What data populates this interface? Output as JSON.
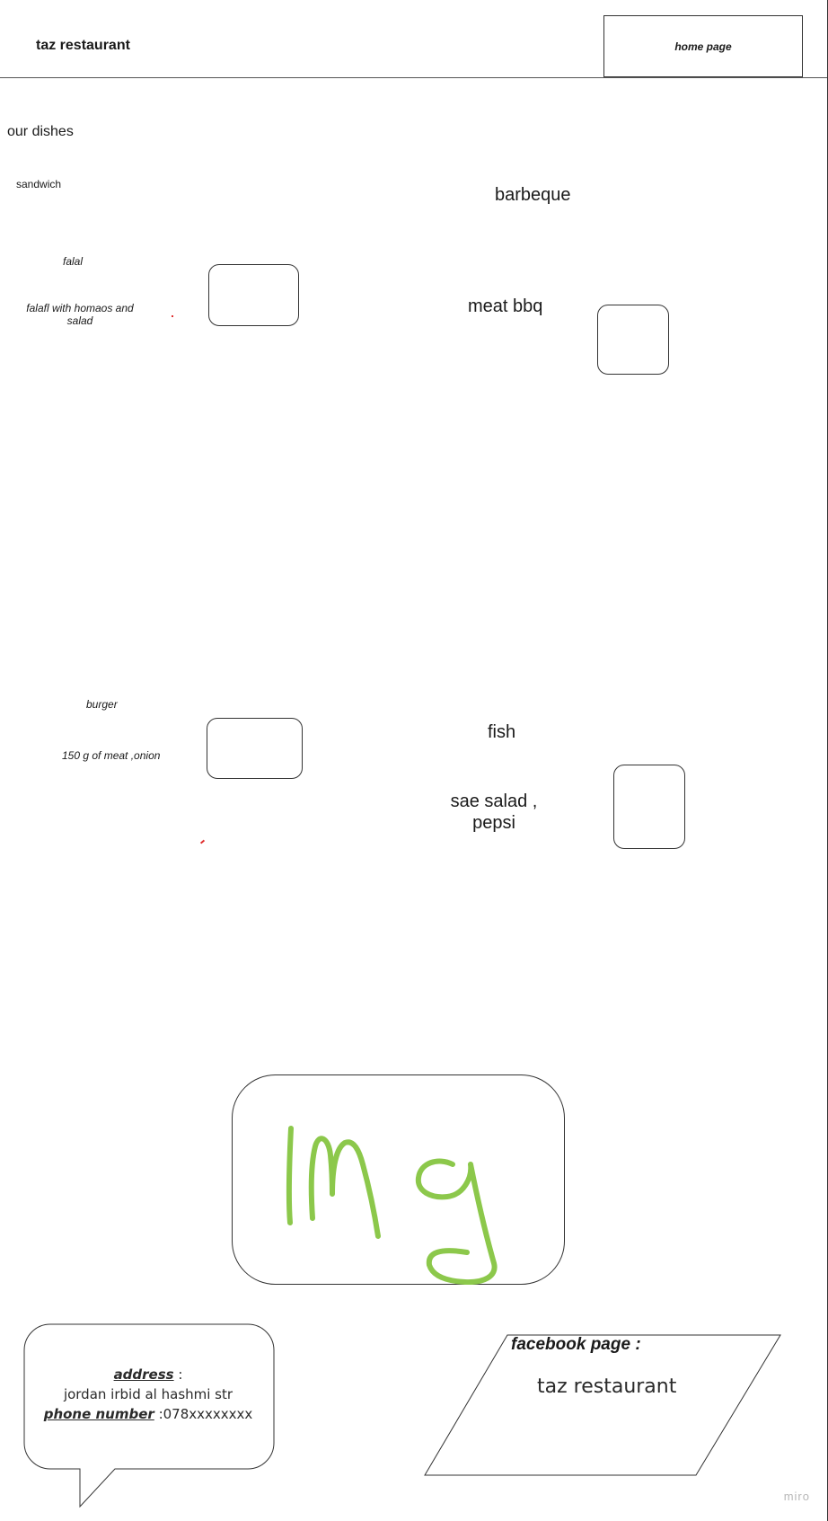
{
  "header": {
    "title": "taz restaurant",
    "home_button": "home page"
  },
  "section_title": "our dishes",
  "sandwich": {
    "category": "sandwich",
    "items": [
      {
        "name": "falal",
        "description": "falafl with homaos and salad"
      },
      {
        "name": "burger",
        "description": "150 g of meat ,onion"
      }
    ]
  },
  "barbeque": {
    "category": "barbeque",
    "items": [
      {
        "name": "meat bbq"
      },
      {
        "name": "fish",
        "description_line1": "sae salad ,",
        "description_line2": "pepsi"
      }
    ]
  },
  "image_placeholder": {
    "label": "Img",
    "stroke_color": "#8cc84b"
  },
  "footer": {
    "address_label": "address",
    "address_value": "jordan irbid  al hashmi str",
    "phone_label": "phone number",
    "phone_value": ":078xxxxxxxx",
    "facebook_label": "facebook page :",
    "facebook_value": "taz restaurant"
  },
  "watermark": "miro"
}
